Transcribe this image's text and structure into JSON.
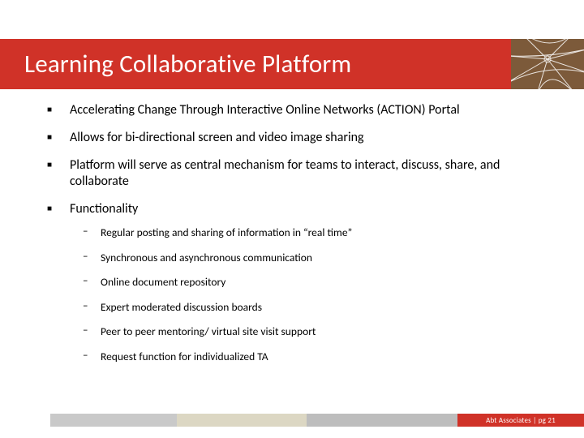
{
  "title": "Learning Collaborative Platform",
  "bullets": [
    "Accelerating Change Through Interactive Online Networks (ACTION) Portal",
    "Allows for bi-directional screen and video image sharing",
    "Platform will serve as central mechanism for teams to interact, discuss, share, and collaborate",
    "Functionality"
  ],
  "sub_bullets": [
    "Regular posting and sharing of information in “real time”",
    "Synchronous and asynchronous communication",
    "Online document repository",
    "Expert moderated discussion boards",
    "Peer to peer mentoring/ virtual site visit support",
    "Request function for individualized TA"
  ],
  "footer": {
    "org": "Abt Associates",
    "page_label": "pg 21"
  }
}
